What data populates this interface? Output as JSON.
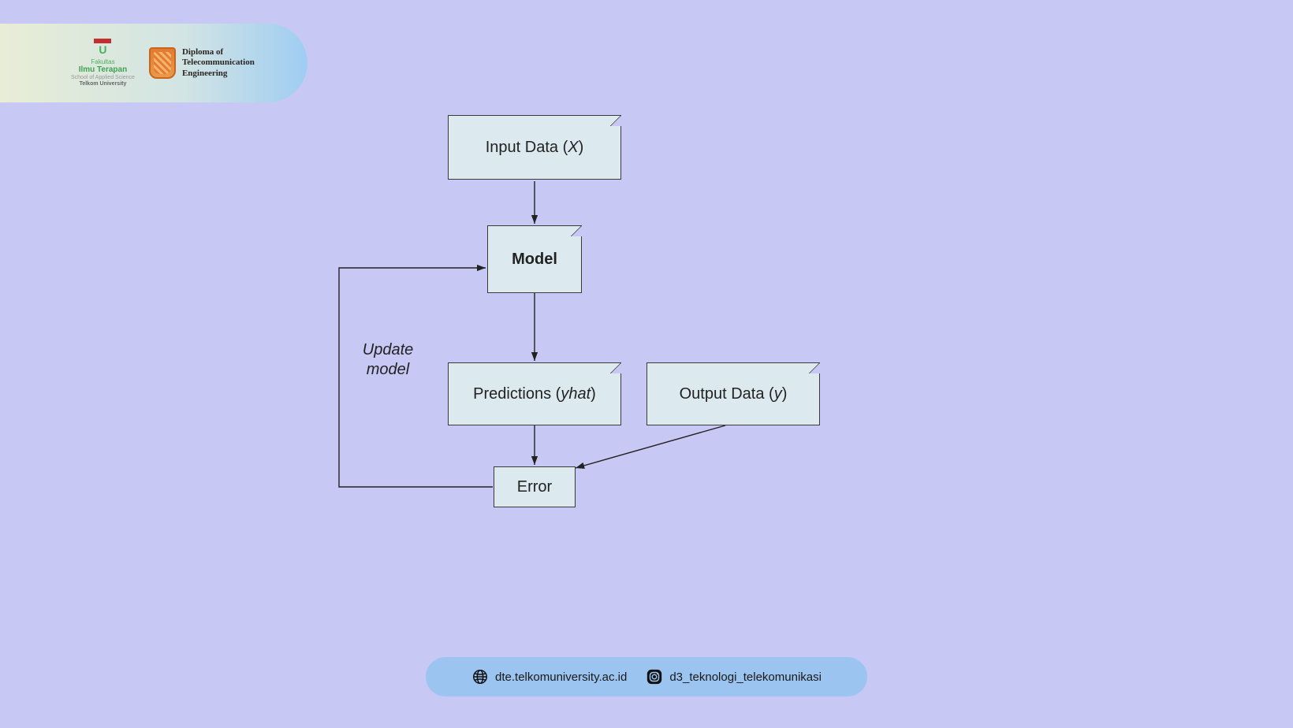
{
  "header": {
    "faculty": {
      "line1": "Fakultas",
      "line2": "Ilmu Terapan",
      "line3": "School of Applied Science",
      "line4": "Telkom University"
    },
    "dept": {
      "line1": "Diploma of",
      "line2": "Telecommunication",
      "line3": "Engineering"
    }
  },
  "diagram": {
    "nodes": {
      "input": {
        "label_a": "Input Data (",
        "var": "X",
        "label_b": ")"
      },
      "model": {
        "label": "Model"
      },
      "predictions": {
        "label_a": "Predictions (",
        "var": "yhat",
        "label_b": ")"
      },
      "output": {
        "label_a": "Output Data (",
        "var": "y",
        "label_b": ")"
      },
      "error": {
        "label": "Error"
      }
    },
    "annotation": {
      "line1": "Update",
      "line2": "model"
    }
  },
  "footer": {
    "website": "dte.telkomuniversity.ac.id",
    "instagram": "d3_teknologi_telekomunikasi"
  }
}
